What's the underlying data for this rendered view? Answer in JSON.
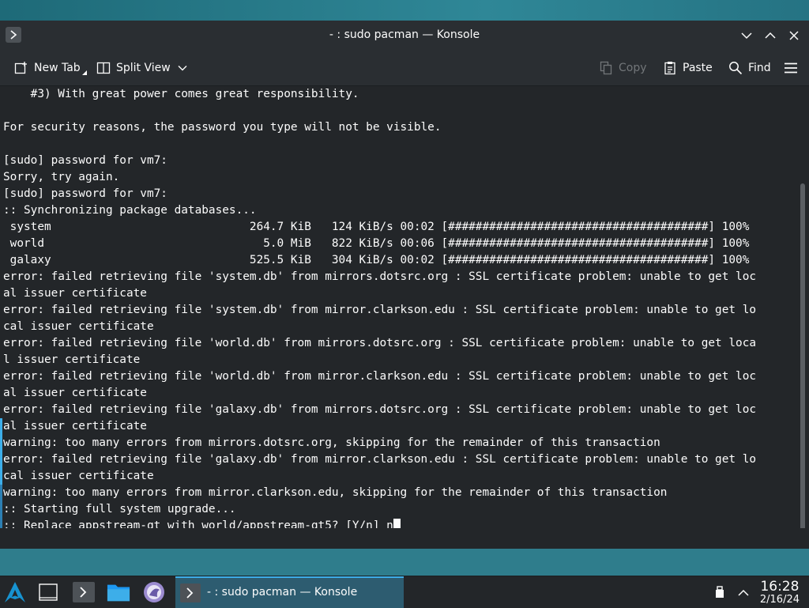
{
  "window": {
    "title": "- : sudo pacman — Konsole"
  },
  "toolbar": {
    "new_tab": "New Tab",
    "split_view": "Split View",
    "copy": "Copy",
    "paste": "Paste",
    "find": "Find"
  },
  "terminal": {
    "lines": [
      "    #3) With great power comes great responsibility.",
      "",
      "For security reasons, the password you type will not be visible.",
      "",
      "[sudo] password for vm7:",
      "Sorry, try again.",
      "[sudo] password for vm7:",
      ":: Synchronizing package databases...",
      " system                             264.7 KiB   124 KiB/s 00:02 [######################################] 100%",
      " world                                5.0 MiB   822 KiB/s 00:06 [######################################] 100%",
      " galaxy                             525.5 KiB   304 KiB/s 00:02 [######################################] 100%",
      "error: failed retrieving file 'system.db' from mirrors.dotsrc.org : SSL certificate problem: unable to get loc",
      "al issuer certificate",
      "error: failed retrieving file 'system.db' from mirror.clarkson.edu : SSL certificate problem: unable to get lo",
      "cal issuer certificate",
      "error: failed retrieving file 'world.db' from mirrors.dotsrc.org : SSL certificate problem: unable to get loca",
      "l issuer certificate",
      "error: failed retrieving file 'world.db' from mirror.clarkson.edu : SSL certificate problem: unable to get loc",
      "al issuer certificate",
      "error: failed retrieving file 'galaxy.db' from mirrors.dotsrc.org : SSL certificate problem: unable to get loc",
      "al issuer certificate",
      "warning: too many errors from mirrors.dotsrc.org, skipping for the remainder of this transaction",
      "error: failed retrieving file 'galaxy.db' from mirror.clarkson.edu : SSL certificate problem: unable to get lo",
      "cal issuer certificate",
      "warning: too many errors from mirror.clarkson.edu, skipping for the remainder of this transaction",
      ":: Starting full system upgrade...",
      ":: Replace appstream-qt with world/appstream-qt5? [Y/n] n"
    ]
  },
  "taskbar": {
    "task_label": "- : sudo pacman — Konsole",
    "clock_time": "16:28",
    "clock_date": "2/16/24"
  },
  "colors": {
    "terminal_bg": "#232629",
    "text": "#fcfcfc",
    "accent": "#3daee9"
  }
}
